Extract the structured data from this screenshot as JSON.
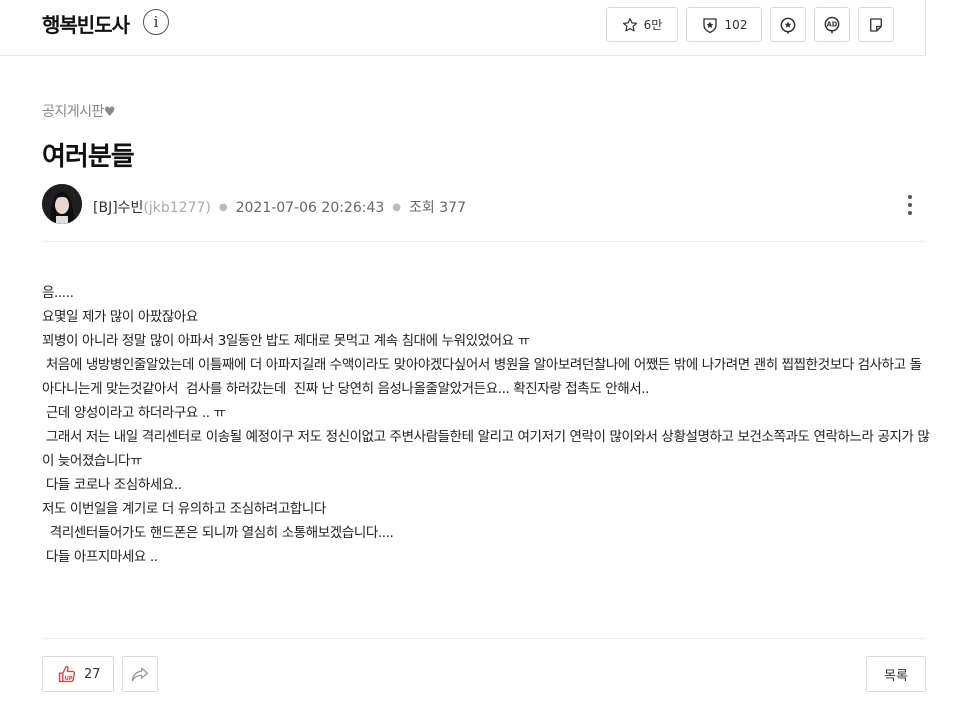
{
  "header": {
    "channel_name": "행복빈도사",
    "info_icon_text": "i",
    "buttons": [
      {
        "icon": "star-icon",
        "label": "6만"
      },
      {
        "icon": "badge-star-icon",
        "label": "102"
      },
      {
        "icon": "sticker-icon",
        "label": ""
      },
      {
        "icon": "ad-icon",
        "label": "AD"
      },
      {
        "icon": "note-icon",
        "label": ""
      }
    ]
  },
  "post": {
    "category": "공지게시판",
    "category_heart": "♥",
    "title": "여러분들",
    "author": "[BJ]수빈",
    "author_id": "(jkb1277)",
    "datetime": "2021-07-06 20:26:43",
    "views_label": "조회",
    "views": "377",
    "body_lines": [
      "음.....",
      "요몇일 제가 많이 아팠잖아요",
      "꾀병이 아니라 정말 많이 아파서 3일동안 밥도 제대로 못먹고 계속 침대에 누워있었어요 ㅠ",
      " 처음에 냉방병인줄알았는데 이틀째에 더 아파지길래 수액이라도 맞아야겠다싶어서 병원을 알아보려던찰나에 어쨌든 밖에 나가려면 괜히 찝찝한것보다 검사하고 돌아다니는게 맞는것같아서  검사를 하러갔는데  진짜 난 당연히 음성나올줄알았거든요... 확진자랑 접촉도 안해서..",
      " 근데 양성이라고 하더라구요 .. ㅠ",
      " 그래서 저는 내일 격리센터로 이송될 예정이구 저도 정신이없고 주변사람들한테 알리고 여기저기 연락이 많이와서 상황설명하고 보건소쪽과도 연락하느라 공지가 많이 늦어졌습니다ㅠ",
      " 다들 코로나 조심하세요..",
      "저도 이번일을 계기로 더 유의하고 조심하려고합니다",
      "  격리센터들어가도 핸드폰은 되니까 열심히 소통해보겠습니다....",
      " 다들 아프지마세요 .."
    ]
  },
  "footer": {
    "like_icon_text": "UP",
    "like_count": "27",
    "list_button": "목록"
  }
}
